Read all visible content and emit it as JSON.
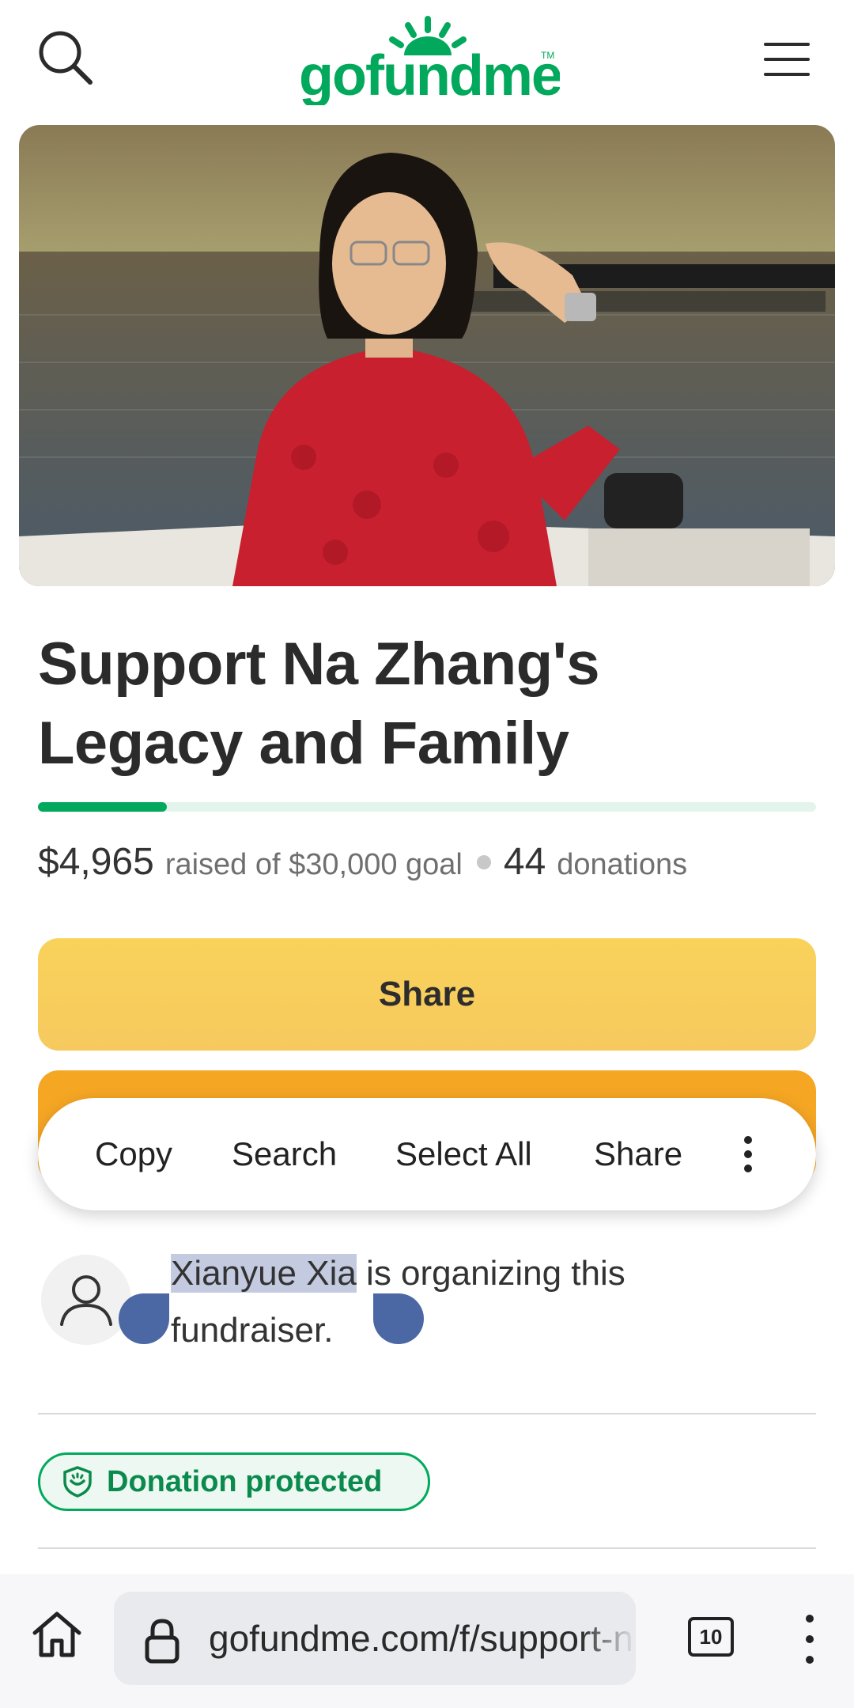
{
  "header": {
    "logo_text": "gofundme",
    "brand_color": "#02a95c"
  },
  "campaign": {
    "title_line1": "Support Na Zhang's",
    "title_line2": "Legacy and Family",
    "progress_fraction": 0.1655,
    "raised": "$4,965",
    "raised_suffix": "raised of $30,000 goal",
    "donations_count": "44",
    "donations_label": "donations"
  },
  "actions": {
    "share_label": "Share",
    "donate_color": "#f5a623"
  },
  "context_menu": {
    "copy": "Copy",
    "search": "Search",
    "select_all": "Select All",
    "share": "Share"
  },
  "organizer": {
    "name": "Xianyue Xia",
    "rest_line1": " is organizing this",
    "line2": "fundraiser."
  },
  "badge": {
    "label": "Donation protected"
  },
  "browser": {
    "url": "gofundme.com/f/support-na-zhangs-legacy",
    "tab_count": "10"
  }
}
